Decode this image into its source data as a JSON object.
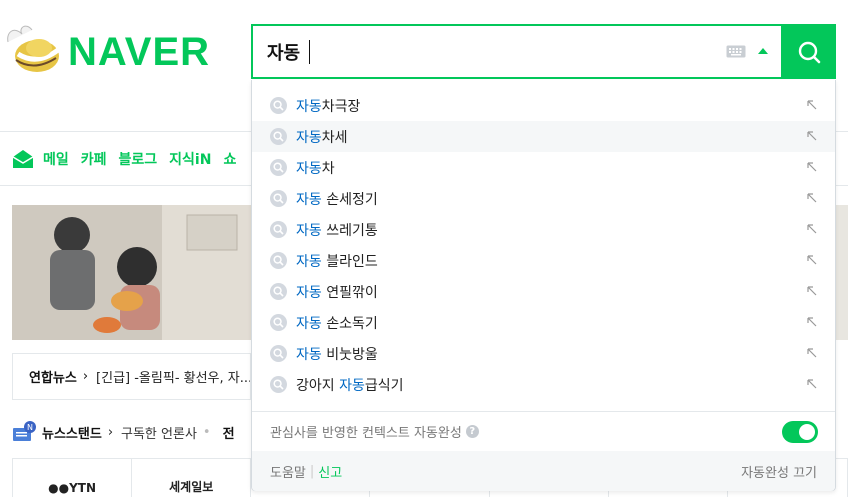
{
  "brand": {
    "logo_text": "NAVER",
    "accent": "#03c75a",
    "link_color": "#0068c3"
  },
  "search": {
    "query": "자동",
    "keyboard_icon": "keyboard-icon",
    "toggle_icon": "arrow-up-icon",
    "button_icon": "search-icon"
  },
  "nav": {
    "items": [
      "메일",
      "카페",
      "블로그",
      "지식iN",
      "쇼"
    ]
  },
  "news": {
    "source": "연합뉴스",
    "headline": "[긴급] -올림픽- 황선우, 자..."
  },
  "newsstand": {
    "badge": "N",
    "title": "뉴스스탠드",
    "subscribed": "구독한 언론사",
    "more": "전"
  },
  "press": [
    "●●YTN",
    "세계일보"
  ],
  "autocomplete": {
    "items": [
      {
        "match": "자동",
        "rest": "차극장",
        "prefix": ""
      },
      {
        "match": "자동",
        "rest": "차세",
        "prefix": ""
      },
      {
        "match": "자동",
        "rest": "차",
        "prefix": ""
      },
      {
        "match": "자동",
        "rest": " 손세정기",
        "prefix": ""
      },
      {
        "match": "자동",
        "rest": " 쓰레기통",
        "prefix": ""
      },
      {
        "match": "자동",
        "rest": " 블라인드",
        "prefix": ""
      },
      {
        "match": "자동",
        "rest": " 연필깎이",
        "prefix": ""
      },
      {
        "match": "자동",
        "rest": " 손소독기",
        "prefix": ""
      },
      {
        "match": "자동",
        "rest": " 비눗방울",
        "prefix": ""
      },
      {
        "match": "자동",
        "rest": "급식기",
        "prefix": "강아지 "
      }
    ],
    "context_label": "관심사를 반영한 컨텍스트 자동완성",
    "context_enabled": true,
    "help_label": "도움말",
    "report_label": "신고",
    "turn_off_label": "자동완성 끄기"
  }
}
